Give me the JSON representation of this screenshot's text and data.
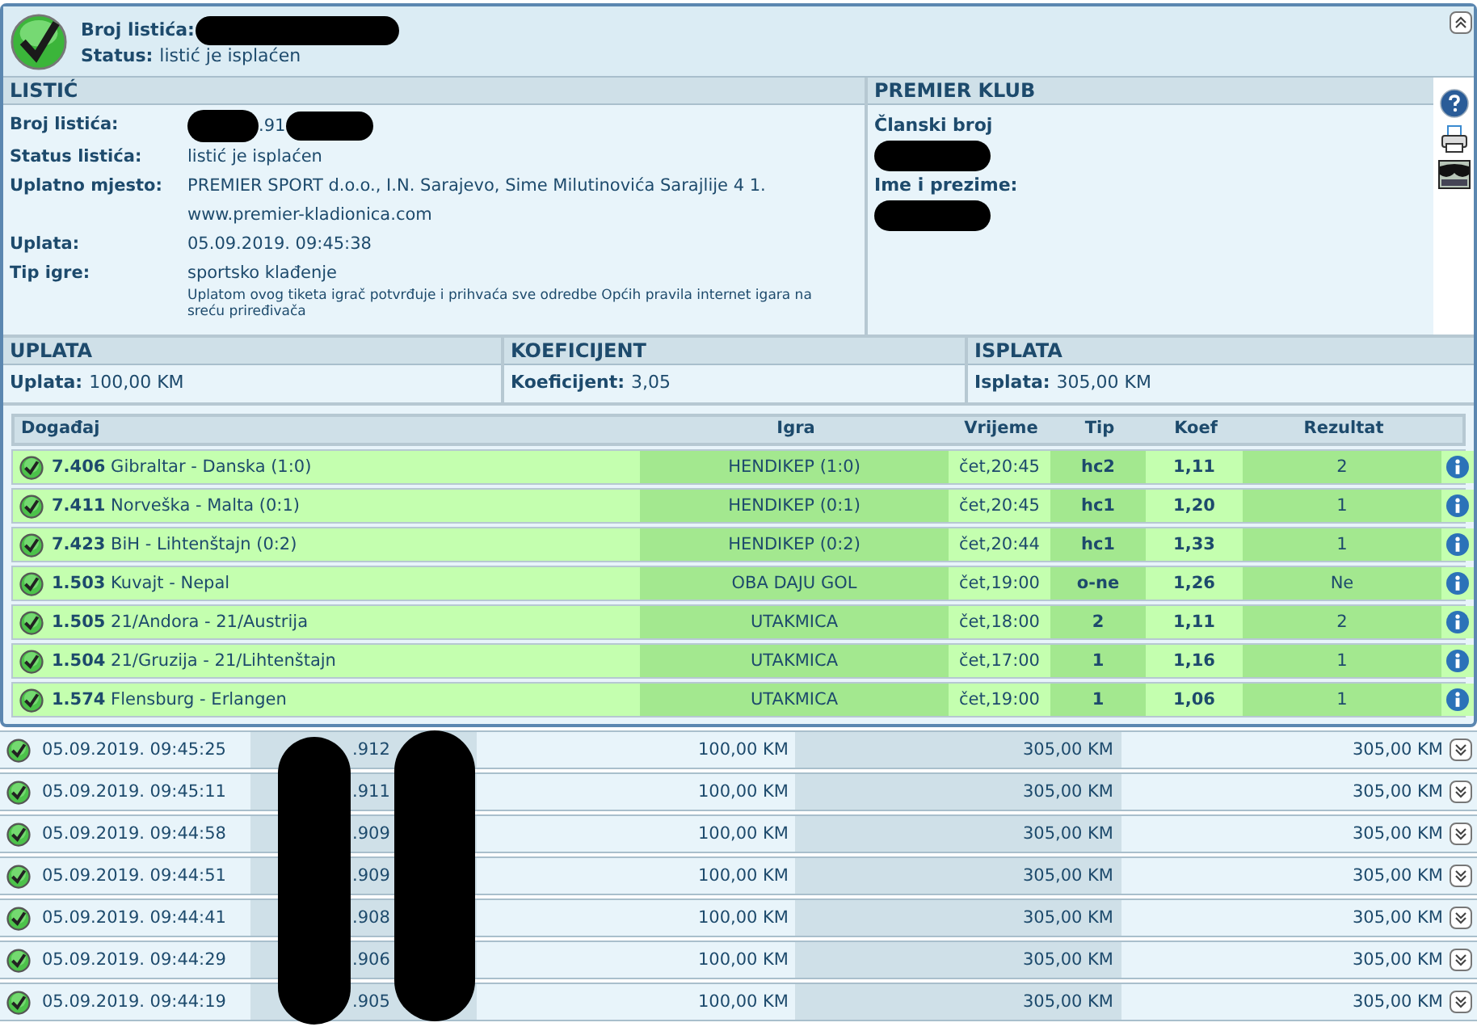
{
  "header": {
    "ticket_label": "Broj listića:",
    "status_label": "Status:",
    "status_value": "listić je isplaćen"
  },
  "listic": {
    "title": "LISTIĆ",
    "fields": [
      {
        "label": "Broj listića:",
        "value": ".91"
      },
      {
        "label": "Status listića:",
        "value": "listić je isplaćen"
      },
      {
        "label": "Uplatno mjesto:",
        "value": "PREMIER SPORT d.o.o., I.N. Sarajevo, Sime Milutinovića Sarajlije 4 1. www.premier-kladionica.com"
      },
      {
        "label": "Uplata:",
        "value": "05.09.2019. 09:45:38"
      },
      {
        "label": "Tip igre:",
        "value": "sportsko klađenje"
      }
    ],
    "notice": "Uplatom ovog tiketa igrač potvrđuje i prihvaća sve odredbe Općih pravila internet igara na sreću priređivača"
  },
  "premier_klub": {
    "title": "PREMIER KLUB",
    "fields": [
      "Članski broj",
      "Ime i prezime:"
    ]
  },
  "summary": [
    {
      "title": "UPLATA",
      "label": "Uplata:",
      "value": "100,00 KM"
    },
    {
      "title": "KOEFICIJENT",
      "label": "Koeficijent:",
      "value": "3,05"
    },
    {
      "title": "ISPLATA",
      "label": "Isplata:",
      "value": "305,00 KM"
    }
  ],
  "events": {
    "columns": [
      "Događaj",
      "Igra",
      "Vrijeme",
      "Tip",
      "Koef",
      "Rezultat"
    ],
    "rows": [
      {
        "code": "7.406",
        "match": "Gibraltar - Danska (1:0)",
        "game": "HENDIKEP (1:0)",
        "time": "čet,20:45",
        "tip": "hc2",
        "koef": "1,11",
        "result": "2"
      },
      {
        "code": "7.411",
        "match": "Norveška - Malta (0:1)",
        "game": "HENDIKEP (0:1)",
        "time": "čet,20:45",
        "tip": "hc1",
        "koef": "1,20",
        "result": "1"
      },
      {
        "code": "7.423",
        "match": "BiH - Lihtenštajn (0:2)",
        "game": "HENDIKEP (0:2)",
        "time": "čet,20:44",
        "tip": "hc1",
        "koef": "1,33",
        "result": "1"
      },
      {
        "code": "1.503",
        "match": "Kuvajt - Nepal",
        "game": "OBA DAJU GOL",
        "time": "čet,19:00",
        "tip": "o-ne",
        "koef": "1,26",
        "result": "Ne"
      },
      {
        "code": "1.505",
        "match": "21/Andora - 21/Austrija",
        "game": "UTAKMICA",
        "time": "čet,18:00",
        "tip": "2",
        "koef": "1,11",
        "result": "2"
      },
      {
        "code": "1.504",
        "match": "21/Gruzija - 21/Lihtenštajn",
        "game": "UTAKMICA",
        "time": "čet,17:00",
        "tip": "1",
        "koef": "1,16",
        "result": "1"
      },
      {
        "code": "1.574",
        "match": "Flensburg - Erlangen",
        "game": "UTAKMICA",
        "time": "čet,19:00",
        "tip": "1",
        "koef": "1,06",
        "result": "1"
      }
    ]
  },
  "tickets": [
    {
      "datetime": "05.09.2019. 09:45:25",
      "number": ".912",
      "stake": "100,00 KM",
      "column_4": "305,00 KM",
      "column_5": "305,00 KM"
    },
    {
      "datetime": "05.09.2019. 09:45:11",
      "number": ".911",
      "stake": "100,00 KM",
      "column_4": "305,00 KM",
      "column_5": "305,00 KM"
    },
    {
      "datetime": "05.09.2019. 09:44:58",
      "number": ".909",
      "stake": "100,00 KM",
      "column_4": "305,00 KM",
      "column_5": "305,00 KM"
    },
    {
      "datetime": "05.09.2019. 09:44:51",
      "number": ".909",
      "stake": "100,00 KM",
      "column_4": "305,00 KM",
      "column_5": "305,00 KM"
    },
    {
      "datetime": "05.09.2019. 09:44:41",
      "number": ".908",
      "stake": "100,00 KM",
      "column_4": "305,00 KM",
      "column_5": "305,00 KM"
    },
    {
      "datetime": "05.09.2019. 09:44:29",
      "number": ".906",
      "stake": "100,00 KM",
      "column_4": "305,00 KM",
      "column_5": "305,00 KM"
    },
    {
      "datetime": "05.09.2019. 09:44:19",
      "number": ".905",
      "stake": "100,00 KM",
      "column_4": "305,00 KM",
      "column_5": "305,00 KM"
    }
  ]
}
